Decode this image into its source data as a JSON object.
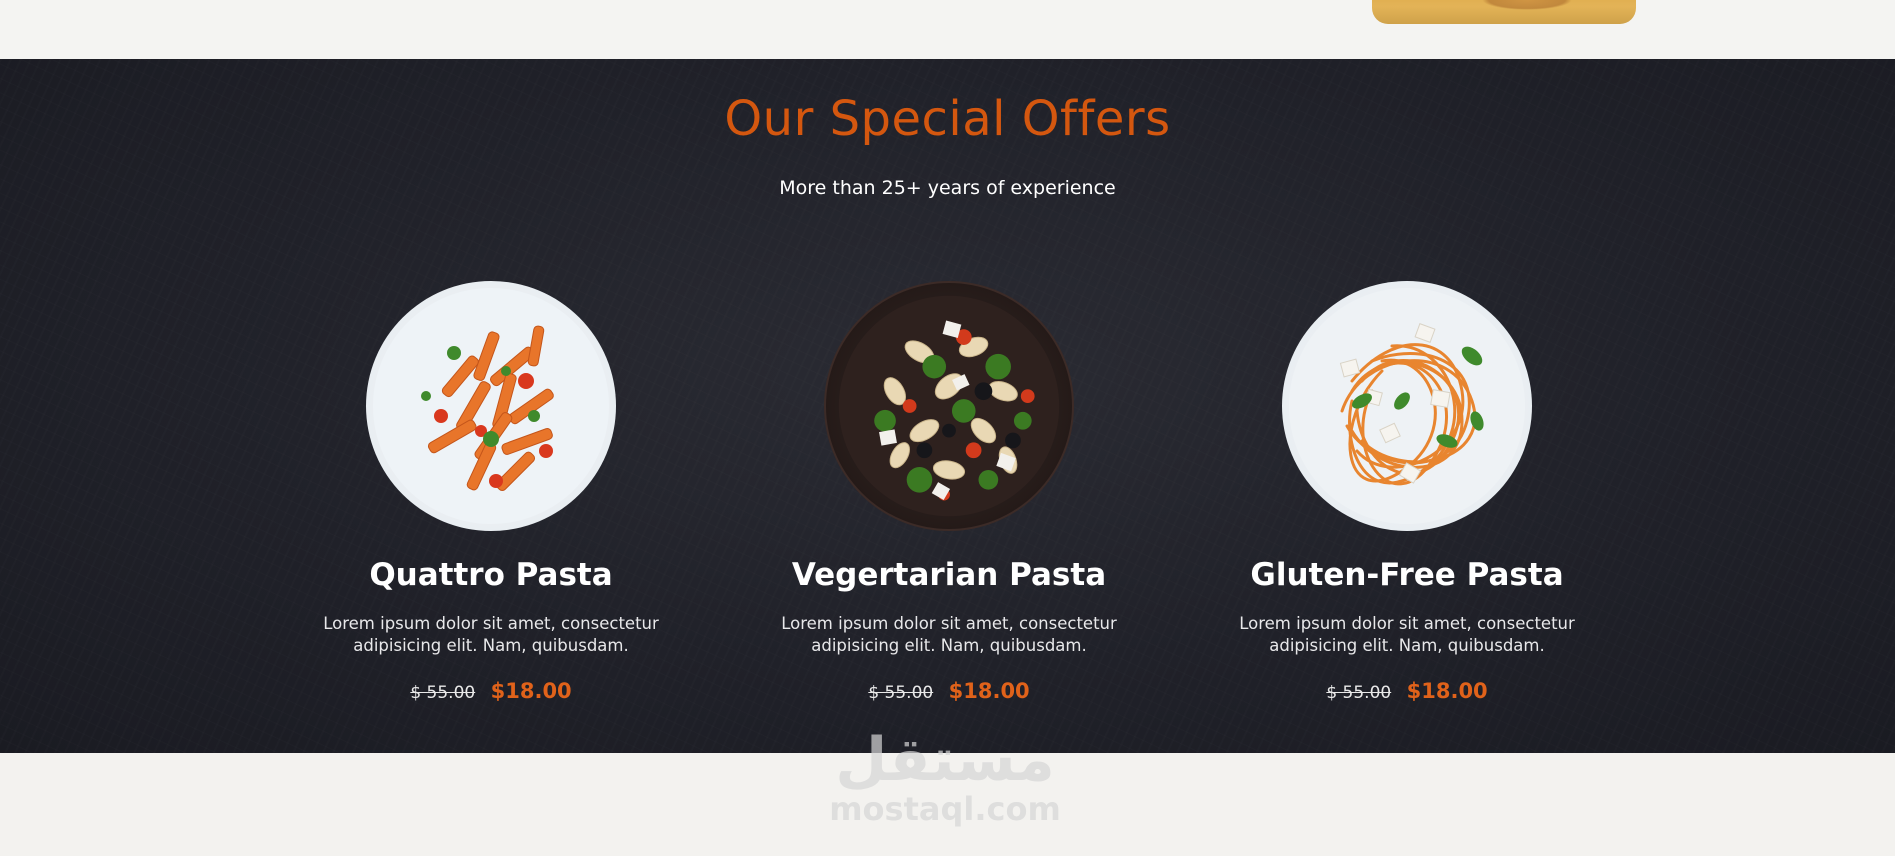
{
  "section": {
    "title": "Our Special Offers",
    "subtitle": "More than 25+ years of experience"
  },
  "offers": [
    {
      "name": "Quattro Pasta",
      "description": "Lorem ipsum dolor sit amet, consectetur adipisicing elit. Nam, quibusdam.",
      "old_price": "$ 55.00",
      "new_price": "$18.00",
      "image_icon": "penne-pasta-plate-image"
    },
    {
      "name": "Vegertarian Pasta",
      "description": "Lorem ipsum dolor sit amet, consectetur adipisicing elit. Nam, quibusdam.",
      "old_price": "$ 55.00",
      "new_price": "$18.00",
      "image_icon": "pasta-salad-bowl-image"
    },
    {
      "name": "Gluten-Free Pasta",
      "description": "Lorem ipsum dolor sit amet, consectetur adipisicing elit. Nam, quibusdam.",
      "old_price": "$ 55.00",
      "new_price": "$18.00",
      "image_icon": "spaghetti-plate-image"
    }
  ],
  "watermark": {
    "logo": "مستقل",
    "text": "mostaql.com"
  },
  "colors": {
    "accent": "#d4570f",
    "price": "#e0621a",
    "section_bg": "#202129",
    "page_bg": "#f3f2ef"
  }
}
